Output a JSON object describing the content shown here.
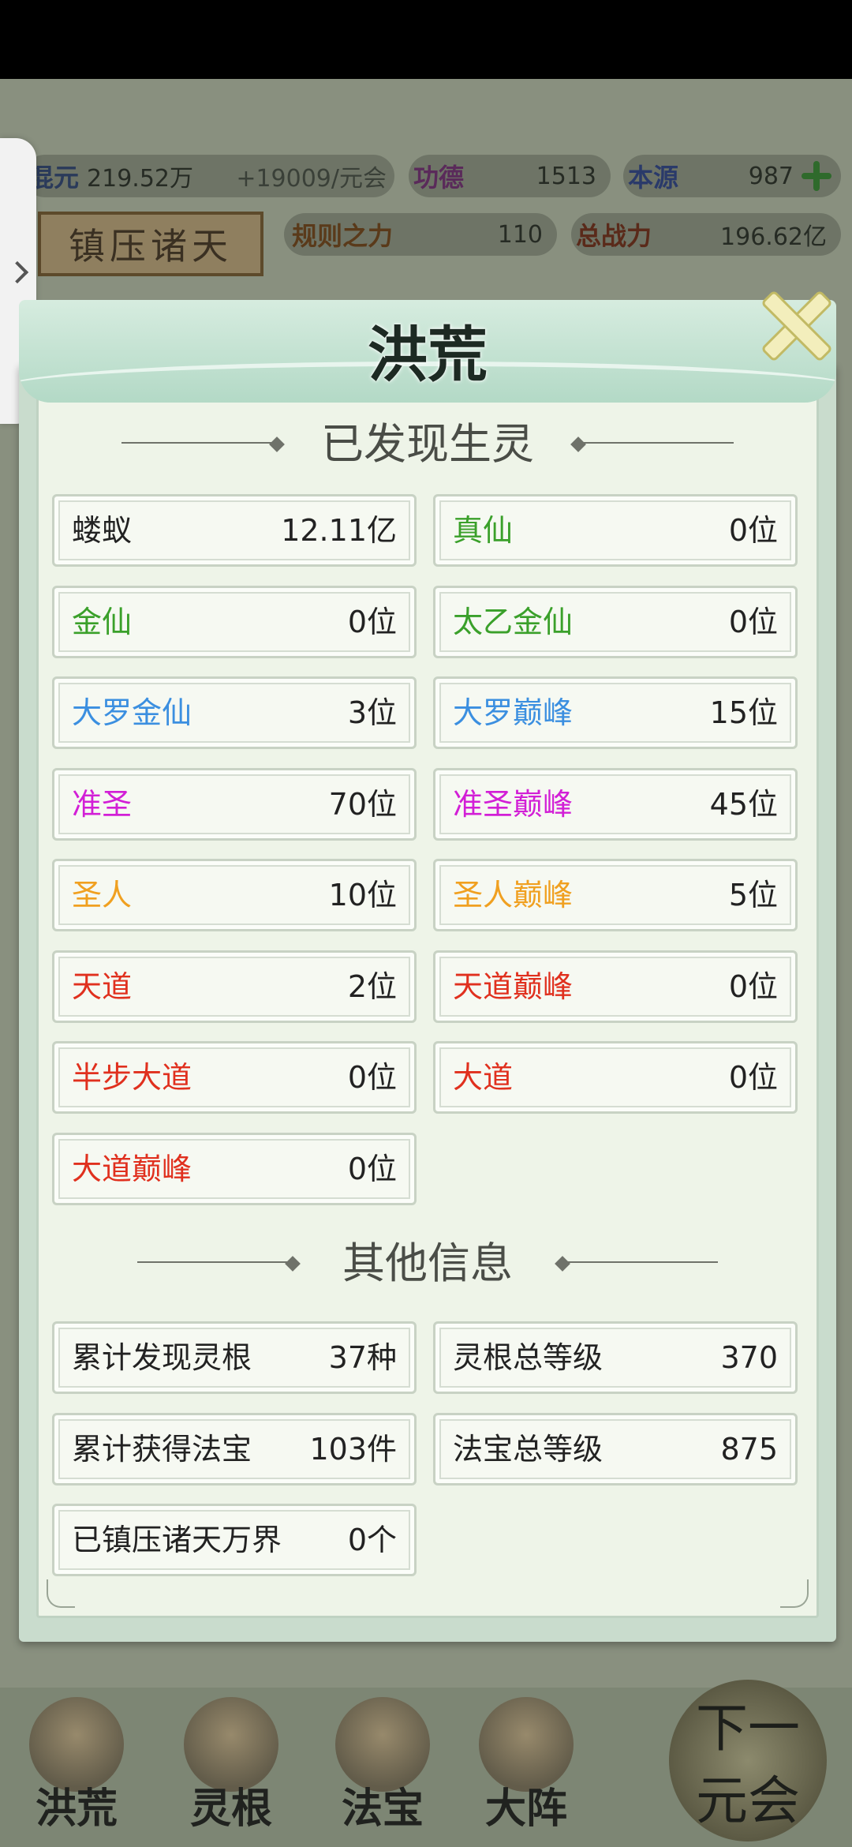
{
  "hud": {
    "row1": [
      {
        "label": "混元",
        "value": "219.52万"
      },
      {
        "label": "",
        "value": "+19009/元会"
      },
      {
        "label": "功德",
        "value": "1513"
      },
      {
        "label": "本源",
        "value": "987"
      }
    ],
    "row2": [
      {
        "label": "规则之力",
        "value": "110"
      },
      {
        "label": "总战力",
        "value": "196.62亿"
      }
    ],
    "banner": "镇压诸天"
  },
  "panel": {
    "title": "洪荒",
    "section1": "已发现生灵",
    "beings": [
      {
        "label": "蝼蚁",
        "value": "12.11亿",
        "color": "#222222"
      },
      {
        "label": "真仙",
        "value": "0位",
        "color": "#3aa02a"
      },
      {
        "label": "金仙",
        "value": "0位",
        "color": "#3aa02a"
      },
      {
        "label": "太乙金仙",
        "value": "0位",
        "color": "#3aa02a"
      },
      {
        "label": "大罗金仙",
        "value": "3位",
        "color": "#3b8fe0"
      },
      {
        "label": "大罗巅峰",
        "value": "15位",
        "color": "#3b8fe0"
      },
      {
        "label": "准圣",
        "value": "70位",
        "color": "#d21fd6"
      },
      {
        "label": "准圣巅峰",
        "value": "45位",
        "color": "#d21fd6"
      },
      {
        "label": "圣人",
        "value": "10位",
        "color": "#f0a020"
      },
      {
        "label": "圣人巅峰",
        "value": "5位",
        "color": "#f0a020"
      },
      {
        "label": "天道",
        "value": "2位",
        "color": "#e0301e"
      },
      {
        "label": "天道巅峰",
        "value": "0位",
        "color": "#e0301e"
      },
      {
        "label": "半步大道",
        "value": "0位",
        "color": "#e0301e"
      },
      {
        "label": "大道",
        "value": "0位",
        "color": "#e0301e"
      },
      {
        "label": "大道巅峰",
        "value": "0位",
        "color": "#e0301e"
      }
    ],
    "section2": "其他信息",
    "info": [
      {
        "label": "累计发现灵根",
        "value": "37种"
      },
      {
        "label": "灵根总等级",
        "value": "370"
      },
      {
        "label": "累计获得法宝",
        "value": "103件"
      },
      {
        "label": "法宝总等级",
        "value": "875"
      },
      {
        "label": "已镇压诸天万界",
        "value": "0个"
      }
    ]
  },
  "nav": [
    {
      "label": "洪荒"
    },
    {
      "label": "灵根"
    },
    {
      "label": "法宝"
    },
    {
      "label": "大阵"
    }
  ],
  "next_era": {
    "line1": "下一",
    "line2": "元会"
  }
}
